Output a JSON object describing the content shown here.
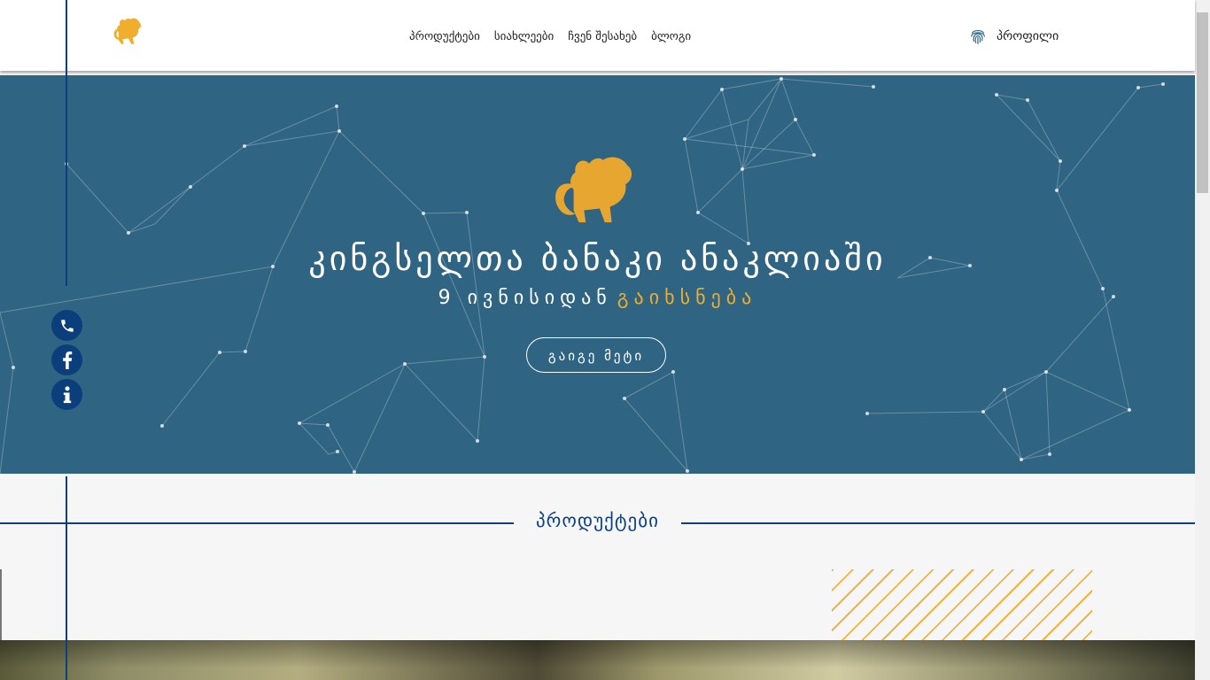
{
  "header": {
    "nav": [
      "პროდუქტები",
      "სიახლეები",
      "ჩვენ შესახებ",
      "ბლოგი"
    ],
    "profile_label": "პროფილი"
  },
  "hero": {
    "title": "კინგსელთა ბანაკი ანაკლიაში",
    "subtitle_prefix": "9 ივნისიდან",
    "subtitle_accent": "გაიხსნება",
    "button_label": "გაიგე მეტი"
  },
  "products": {
    "section_title": "პროდუქტები"
  },
  "colors": {
    "hero_bg": "#2f6482",
    "accent": "#f0ae2c",
    "brand_blue": "#0e3f7c"
  },
  "icons": [
    "lion-logo-icon",
    "fingerprint-icon",
    "phone-icon",
    "facebook-icon",
    "info-icon"
  ]
}
